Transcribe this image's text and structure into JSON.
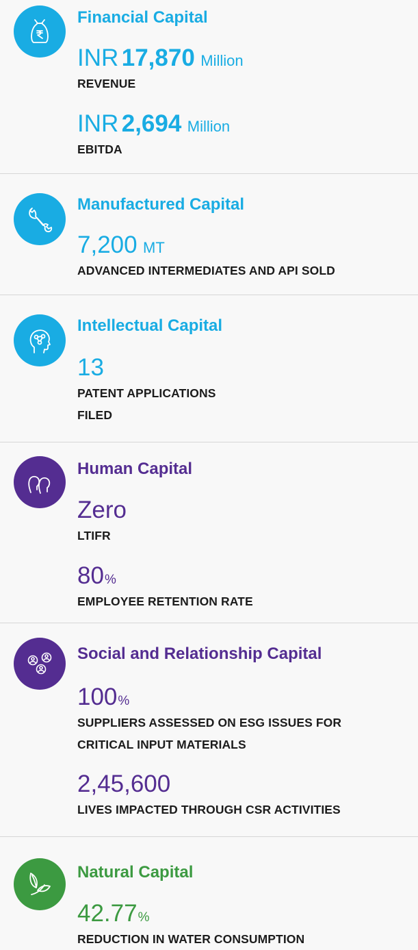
{
  "colors": {
    "blue": "#19ace3",
    "purple": "#542d91",
    "green": "#3c9a41"
  },
  "sections": [
    {
      "title": "Financial Capital",
      "icon": "money-bag-rupee-icon",
      "metrics": [
        {
          "prefix": "INR",
          "value": "17,870",
          "unit": "Million",
          "label": "REVENUE"
        },
        {
          "prefix": "INR",
          "value": "2,694",
          "unit": "Million",
          "label": "EBITDA"
        }
      ]
    },
    {
      "title": "Manufactured Capital",
      "icon": "wrench-icon",
      "metrics": [
        {
          "value": "7,200",
          "unit": "MT",
          "label": "ADVANCED INTERMEDIATES AND API SOLD"
        }
      ]
    },
    {
      "title": "Intellectual Capital",
      "icon": "head-network-icon",
      "metrics": [
        {
          "value": "13",
          "label_line1": "PATENT APPLICATIONS",
          "label_line2": "FILED"
        }
      ]
    },
    {
      "title": "Human Capital",
      "icon": "people-heads-icon",
      "metrics": [
        {
          "value": "Zero",
          "label": "LTIFR"
        },
        {
          "value": "80",
          "unit": "%",
          "label": "EMPLOYEE RETENTION RATE"
        }
      ]
    },
    {
      "title": "Social and Relationship Capital",
      "icon": "community-people-icon",
      "metrics": [
        {
          "value": "100",
          "unit": "%",
          "label_line1": "SUPPLIERS ASSESSED ON ESG ISSUES FOR",
          "label_line2": "CRITICAL INPUT MATERIALS"
        },
        {
          "value": "2,45,600",
          "label": "LIVES IMPACTED THROUGH CSR ACTIVITIES"
        }
      ]
    },
    {
      "title": "Natural Capital",
      "icon": "leaf-icon",
      "metrics": [
        {
          "value": "42.77",
          "unit": "%",
          "label": "REDUCTION IN WATER CONSUMPTION"
        }
      ]
    }
  ]
}
